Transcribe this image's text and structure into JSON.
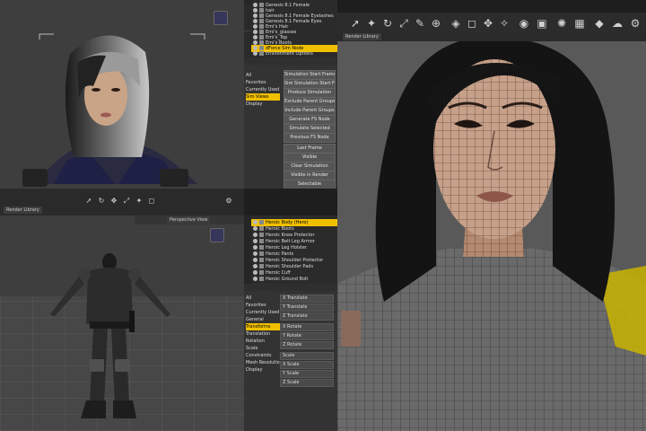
{
  "top_scene": {
    "rows": [
      {
        "label": "Genesis 8.1 Female"
      },
      {
        "label": "hair"
      },
      {
        "label": "Genesis 8.1 Female Eyelashes"
      },
      {
        "label": "Genesis 8.1 Female Eyes"
      },
      {
        "label": "Emi's Hair"
      },
      {
        "label": "Emi's_glasses"
      },
      {
        "label": "Emi's_Top"
      },
      {
        "label": "Emi's Boots"
      },
      {
        "label": "dForce Sim Node"
      },
      {
        "label": "Environment Options"
      }
    ],
    "selected_index": 8,
    "tab": "Render Library"
  },
  "sim_panel": {
    "tree": [
      "All",
      "Favorites",
      "Currently Used",
      "Sim Views",
      "Display"
    ],
    "tree_selected": 3,
    "buttons": [
      "Simulation Start Frame",
      "Sim Simulation Start Frame",
      "Produce Simulation",
      "Exclude Parent Groups",
      "Include Parent Groups",
      "Generate FS Node",
      "Simulate Selected",
      "Previous FS Node",
      "Last Frame",
      "Visible",
      "Clear Simulation",
      "Visible in Render",
      "Selectable",
      "Collide w Sim..."
    ]
  },
  "bottom_scene": {
    "rows": [
      {
        "label": "Heroic Body (Hero)"
      },
      {
        "label": "Heroic Boots"
      },
      {
        "label": "Heroic Knee Protector"
      },
      {
        "label": "Heroic Belt Leg Armor"
      },
      {
        "label": "Heroic Leg Holster"
      },
      {
        "label": "Heroic Pants"
      },
      {
        "label": "Heroic Shoulder Protector"
      },
      {
        "label": "Heroic Shoulder Pads"
      },
      {
        "label": "Heroic Cuff"
      },
      {
        "label": "Heroic Ground Bolt"
      }
    ],
    "selected_index": 0,
    "tab": "Perspective View"
  },
  "params_panel": {
    "tree": [
      "All",
      "Favorites",
      "Currently Used",
      "General",
      "Transforms",
      "Translation",
      "Rotation",
      "Scale",
      "Constraints",
      "Mesh Resolution",
      "Display"
    ],
    "tree_selected": 4,
    "sliders": [
      "X Translate",
      "Y Translate",
      "Z Translate",
      "X Rotate",
      "Y Rotate",
      "Z Rotate",
      "Scale",
      "X Scale",
      "Y Scale",
      "Z Scale"
    ]
  },
  "left_tab": "Render Library",
  "colors": {
    "accent": "#f0c000",
    "viewport": "#3e3e3e",
    "panel": "#2b2b2b"
  },
  "toolbar_icons": [
    "pointer-icon",
    "node-icon",
    "rotate-icon",
    "scale-icon",
    "brush-icon",
    "gizmo-icon",
    "joint-icon",
    "cube-icon",
    "move-icon",
    "wand-icon",
    "eye-icon",
    "camera-icon",
    "spot-icon",
    "grid-icon",
    "render-icon",
    "cloud-icon",
    "gear-icon"
  ]
}
